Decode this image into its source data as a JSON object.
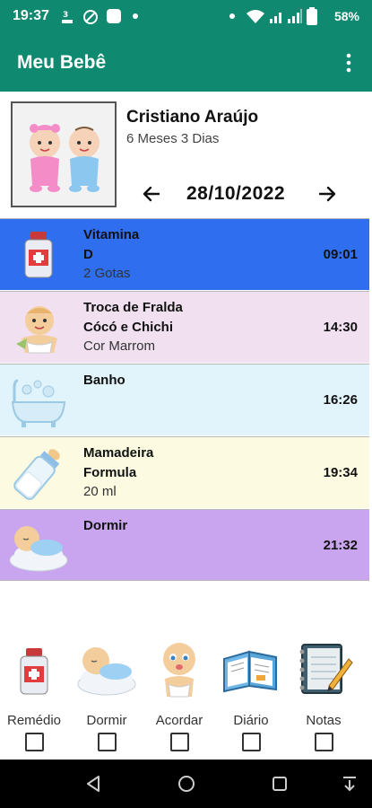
{
  "status_bar": {
    "time": "19:37",
    "battery": "58%"
  },
  "app": {
    "title": "Meu Bebê",
    "menu_icon": "more-vert-icon"
  },
  "profile": {
    "name": "Cristiano Araújo",
    "age": "6 Meses 3 Dias",
    "date": "28/10/2022"
  },
  "events": [
    {
      "line1": "Vitamina",
      "line2": "D",
      "line3": "2 Gotas",
      "time": "09:01",
      "icon": "medicine-bottle-icon",
      "color": "#2f6fef"
    },
    {
      "line1": "Troca de Fralda",
      "line2": "Cócó e Chichi",
      "line3": "Cor Marrom",
      "time": "14:30",
      "icon": "diaper-baby-icon",
      "color": "#f0e0f0"
    },
    {
      "line1": "Banho",
      "line2": "",
      "line3": "",
      "time": "16:26",
      "icon": "bathtub-icon",
      "color": "#e1f3fb"
    },
    {
      "line1": "Mamadeira",
      "line2": "Formula",
      "line3": "20 ml",
      "time": "19:34",
      "icon": "baby-bottle-icon",
      "color": "#fcfbe2"
    },
    {
      "line1": "Dormir",
      "line2": "",
      "line3": "",
      "time": "21:32",
      "icon": "sleeping-baby-icon",
      "color": "#c8a5ee"
    }
  ],
  "actions": [
    {
      "label": "Remédio",
      "icon": "medicine-bottle-icon"
    },
    {
      "label": "Dormir",
      "icon": "sleeping-baby-icon"
    },
    {
      "label": "Acordar",
      "icon": "awake-baby-icon"
    },
    {
      "label": "Diário",
      "icon": "diary-book-icon"
    },
    {
      "label": "Notas",
      "icon": "notebook-icon"
    }
  ],
  "colors": {
    "primary": "#0f8a70"
  }
}
